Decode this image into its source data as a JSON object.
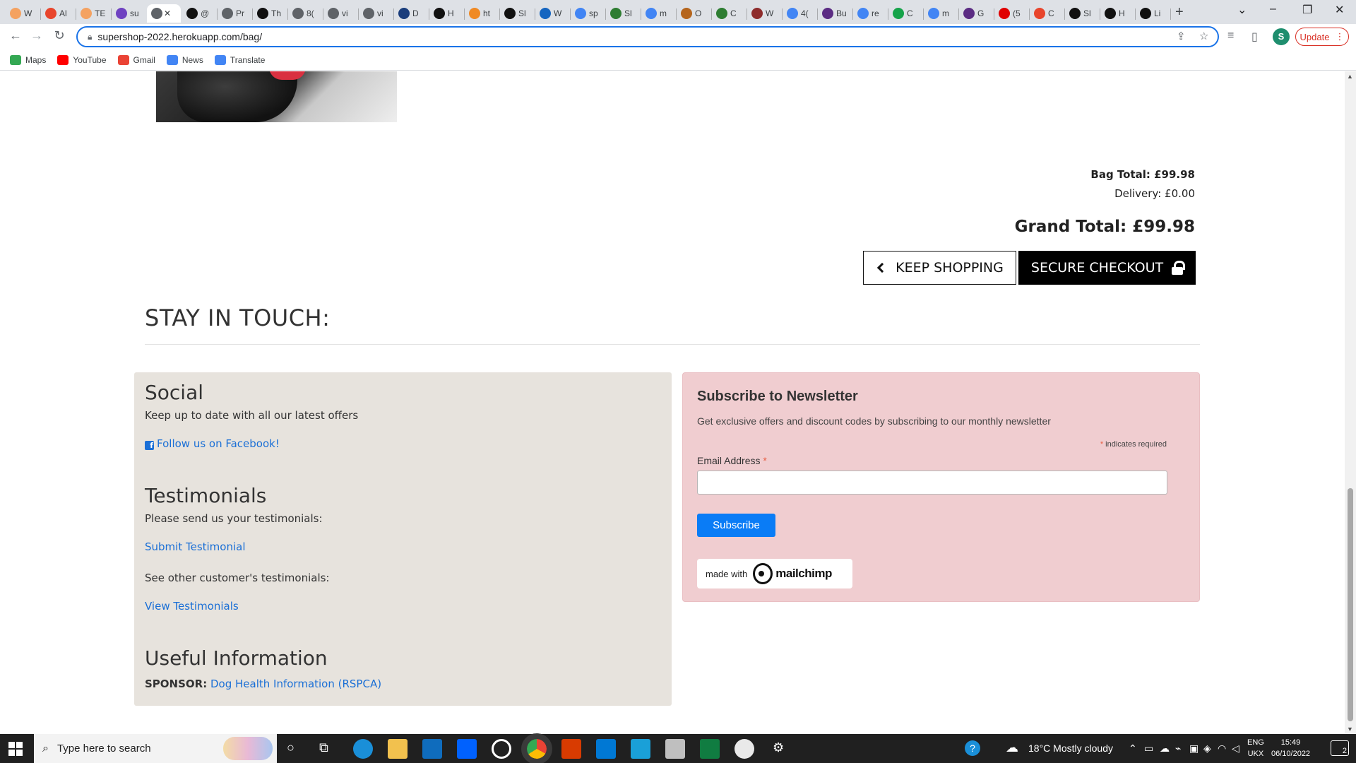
{
  "browser": {
    "tabs": [
      {
        "label": "W",
        "color": "#f4a261"
      },
      {
        "label": "Al",
        "color": "#e8452c"
      },
      {
        "label": "TE",
        "color": "#f4a261"
      },
      {
        "label": "su",
        "color": "#6f42c1"
      },
      {
        "label": "",
        "color": "#5f6368",
        "active": true
      },
      {
        "label": "@",
        "color": "#111111"
      },
      {
        "label": "Pr",
        "color": "#5f6368"
      },
      {
        "label": "Th",
        "color": "#111111"
      },
      {
        "label": "8(",
        "color": "#5f6368"
      },
      {
        "label": "vi",
        "color": "#5f6368"
      },
      {
        "label": "vi",
        "color": "#5f6368"
      },
      {
        "label": "D",
        "color": "#1a3d7c"
      },
      {
        "label": "H",
        "color": "#111111"
      },
      {
        "label": "ht",
        "color": "#f08a24"
      },
      {
        "label": "Sl",
        "color": "#111111"
      },
      {
        "label": "W",
        "color": "#1565c0"
      },
      {
        "label": "sp",
        "color": "#4285f4"
      },
      {
        "label": "Sl",
        "color": "#2e7d32"
      },
      {
        "label": "m",
        "color": "#4285f4"
      },
      {
        "label": "O",
        "color": "#b5651d"
      },
      {
        "label": "C",
        "color": "#2e7d32"
      },
      {
        "label": "W",
        "color": "#8e2c2c"
      },
      {
        "label": "4(",
        "color": "#4285f4"
      },
      {
        "label": "Bu",
        "color": "#5b2c83"
      },
      {
        "label": "re",
        "color": "#4285f4"
      },
      {
        "label": "C",
        "color": "#16a34a"
      },
      {
        "label": "m",
        "color": "#4285f4"
      },
      {
        "label": "G",
        "color": "#5b2c83"
      },
      {
        "label": "(5",
        "color": "#e00000"
      },
      {
        "label": "C",
        "color": "#e8452c"
      },
      {
        "label": "Sl",
        "color": "#111111"
      },
      {
        "label": "H",
        "color": "#111111"
      },
      {
        "label": "Li",
        "color": "#111111"
      }
    ],
    "url": "supershop-2022.herokuapp.com/bag/",
    "update_label": "Update",
    "profile_initial": "S",
    "bookmarks": [
      {
        "label": "Maps",
        "color": "#34a853"
      },
      {
        "label": "YouTube",
        "color": "#ff0000"
      },
      {
        "label": "Gmail",
        "color": "#ea4335"
      },
      {
        "label": "News",
        "color": "#4285f4"
      },
      {
        "label": "Translate",
        "color": "#4285f4"
      }
    ]
  },
  "bag": {
    "bag_total": "Bag Total: £99.98",
    "delivery": "Delivery: £0.00",
    "grand_total": "Grand Total: £99.98",
    "keep_shopping": "KEEP SHOPPING",
    "secure_checkout": "SECURE CHECKOUT"
  },
  "footer": {
    "heading": "STAY IN TOUCH:",
    "social": {
      "title": "Social",
      "text": "Keep up to date with all our latest offers",
      "facebook_link": "Follow us on Facebook!"
    },
    "testimonials": {
      "title": "Testimonials",
      "text1": "Please send us your testimonials:",
      "submit_link": "Submit Testimonial",
      "text2": "See other customer's testimonials:",
      "view_link": "View Testimonials"
    },
    "useful": {
      "title": "Useful Information",
      "sponsor_label": "SPONSOR:",
      "sponsor_link": "Dog Health Information (RSPCA)"
    },
    "newsletter": {
      "title": "Subscribe to Newsletter",
      "description": "Get exclusive offers and discount codes by subscribing to our monthly newsletter",
      "required_asterisk": "*",
      "required_note": "indicates required",
      "email_label": "Email Address",
      "email_value": "",
      "subscribe_label": "Subscribe",
      "badge_made_with": "made with",
      "badge_brand": "mailchimp"
    }
  },
  "taskbar": {
    "search_placeholder": "Type here to search",
    "weather": "18°C  Mostly cloudy",
    "lang_line1": "ENG",
    "lang_line2": "UKX",
    "time": "15:49",
    "date": "06/10/2022",
    "notifications": "2"
  }
}
